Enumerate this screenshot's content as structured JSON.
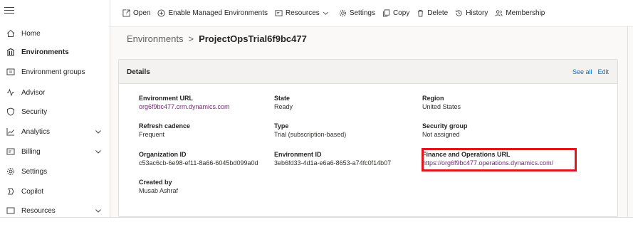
{
  "sidebar": {
    "items": [
      {
        "label": "Home",
        "icon": "home-icon"
      },
      {
        "label": "Environments",
        "icon": "environments-icon",
        "active": true
      },
      {
        "label": "Environment groups",
        "icon": "environment-groups-icon"
      },
      {
        "label": "Advisor",
        "icon": "advisor-icon"
      },
      {
        "label": "Security",
        "icon": "shield-icon"
      },
      {
        "label": "Analytics",
        "icon": "analytics-icon",
        "expandable": true
      },
      {
        "label": "Billing",
        "icon": "billing-icon",
        "expandable": true
      },
      {
        "label": "Settings",
        "icon": "gear-icon"
      },
      {
        "label": "Copilot",
        "icon": "copilot-icon"
      },
      {
        "label": "Resources",
        "icon": "resources-icon",
        "expandable": true
      }
    ]
  },
  "commandbar": {
    "open": "Open",
    "enable_managed": "Enable Managed Environments",
    "resources": "Resources",
    "settings": "Settings",
    "copy": "Copy",
    "delete": "Delete",
    "history": "History",
    "membership": "Membership"
  },
  "breadcrumb": {
    "parent": "Environments",
    "separator": ">",
    "current": "ProjectOpsTrial6f9bc477"
  },
  "details": {
    "title": "Details",
    "see_all": "See all",
    "edit": "Edit",
    "fields": {
      "env_url": {
        "label": "Environment URL",
        "value": "org6f9bc477.crm.dynamics.com"
      },
      "state": {
        "label": "State",
        "value": "Ready"
      },
      "region": {
        "label": "Region",
        "value": "United States"
      },
      "refresh": {
        "label": "Refresh cadence",
        "value": "Frequent"
      },
      "type": {
        "label": "Type",
        "value": "Trial (subscription-based)"
      },
      "security_group": {
        "label": "Security group",
        "value": "Not assigned"
      },
      "org_id": {
        "label": "Organization ID",
        "value": "c53ac6cb-6e98-ef11-8a66-6045bd099a0d"
      },
      "env_id": {
        "label": "Environment ID",
        "value": "3eb6fd33-4d1a-e6a6-8653-a74fc0f14b07"
      },
      "fo_url": {
        "label": "Finance and Operations URL",
        "value": "https://org6f9bc477.operations.dynamics.com/"
      },
      "created_by": {
        "label": "Created by",
        "value": "Musab Ashraf"
      }
    }
  },
  "colors": {
    "link_purple": "#742774",
    "link_blue": "#0f6cbd",
    "highlight_red": "#e0161c"
  }
}
